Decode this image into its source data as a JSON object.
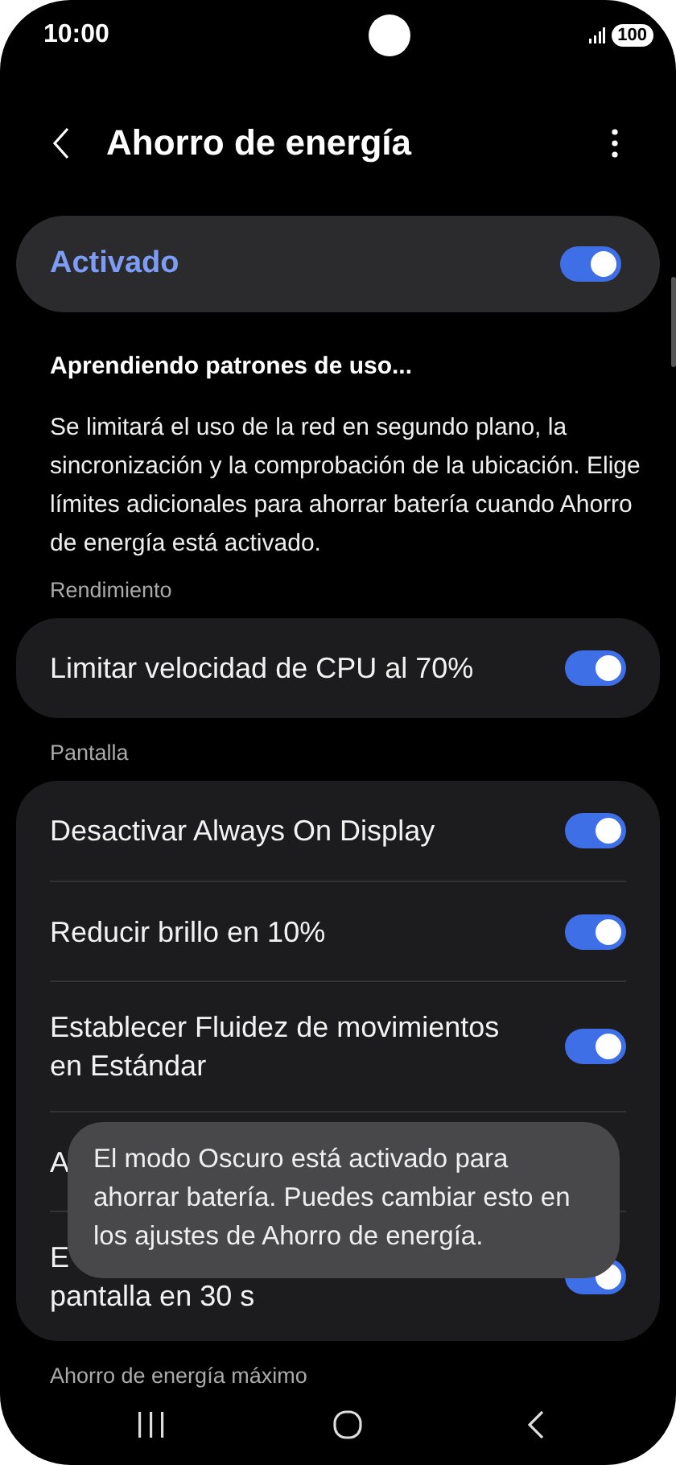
{
  "status_bar": {
    "time": "10:00",
    "battery": "100"
  },
  "header": {
    "title": "Ahorro de energía"
  },
  "master": {
    "label": "Activado",
    "on": true
  },
  "learning": {
    "title": "Aprendiendo patrones de uso...",
    "description": "Se limitará el uso de la red en segundo plano, la sincronización y la comprobación de la ubicación. Elige límites adicionales para ahorrar batería cuando Ahorro de energía está activado."
  },
  "sections": [
    {
      "title": "Rendimiento",
      "items": [
        {
          "lines": [
            "Limitar velocidad de CPU al 70%"
          ],
          "on": true
        }
      ]
    },
    {
      "title": "Pantalla",
      "items": [
        {
          "lines": [
            "Desactivar Always On Display"
          ],
          "on": true
        },
        {
          "lines": [
            "Reducir brillo en 10%"
          ],
          "on": true
        },
        {
          "lines": [
            "Establecer Fluidez de movimientos",
            "en Estándar"
          ],
          "on": true
        },
        {
          "lines": [
            "A"
          ]
        },
        {
          "lines": [
            "E",
            "pantalla en 30 s"
          ],
          "on": true
        }
      ]
    }
  ],
  "next_section": {
    "title": "Ahorro de energía máximo"
  },
  "toast": {
    "text": "El modo Oscuro está activado para ahorrar batería. Puedes cambiar esto en los ajustes de Ahorro de energía."
  }
}
